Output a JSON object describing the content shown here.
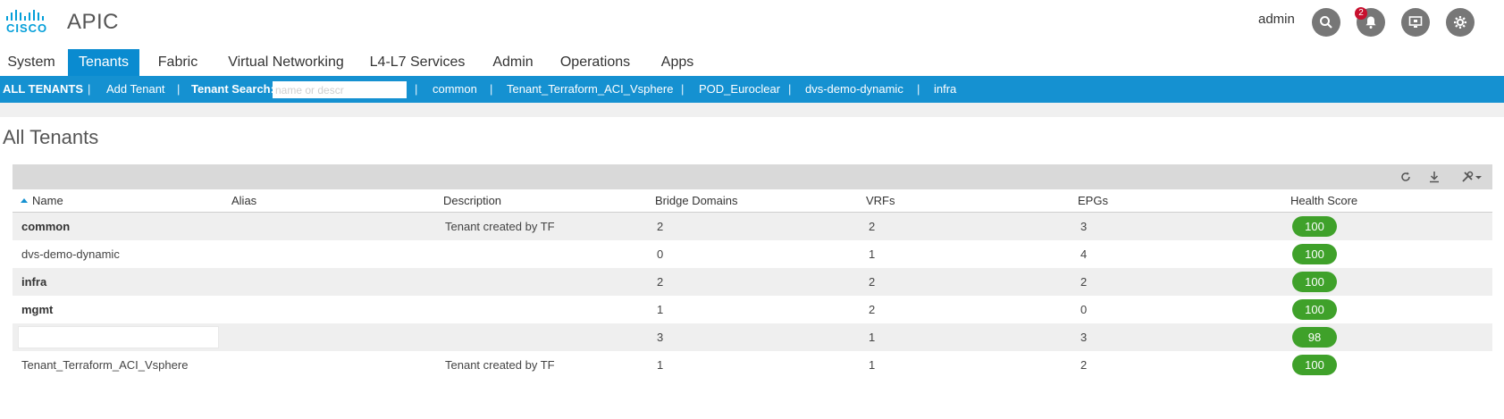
{
  "header": {
    "logo_text": "CISCO",
    "app_title": "APIC",
    "user": "admin",
    "notification_count": "2"
  },
  "tabs": [
    {
      "label": "System"
    },
    {
      "label": "Tenants"
    },
    {
      "label": "Fabric"
    },
    {
      "label": "Virtual Networking"
    },
    {
      "label": "L4-L7 Services"
    },
    {
      "label": "Admin"
    },
    {
      "label": "Operations"
    },
    {
      "label": "Apps"
    }
  ],
  "subnav": {
    "all_tenants": "ALL TENANTS",
    "add_tenant": "Add Tenant",
    "search_label": "Tenant Search:",
    "search_placeholder": "name or descr",
    "recent": [
      "common",
      "Tenant_Terraform_ACI_Vsphere",
      "POD_Euroclear",
      "dvs-demo-dynamic",
      "infra"
    ]
  },
  "page_title": "All Tenants",
  "table": {
    "columns": [
      "Name",
      "Alias",
      "Description",
      "Bridge Domains",
      "VRFs",
      "EPGs",
      "Health Score"
    ],
    "rows": [
      {
        "name": "common",
        "alias": "",
        "description": "Tenant created by TF",
        "bd": "2",
        "vrfs": "2",
        "epgs": "3",
        "health": "100"
      },
      {
        "name": "dvs-demo-dynamic",
        "alias": "",
        "description": "",
        "bd": "0",
        "vrfs": "1",
        "epgs": "4",
        "health": "100"
      },
      {
        "name": "infra",
        "alias": "",
        "description": "",
        "bd": "2",
        "vrfs": "2",
        "epgs": "2",
        "health": "100"
      },
      {
        "name": "mgmt",
        "alias": "",
        "description": "",
        "bd": "1",
        "vrfs": "2",
        "epgs": "0",
        "health": "100"
      },
      {
        "name": "",
        "alias": "",
        "description": "",
        "bd": "3",
        "vrfs": "1",
        "epgs": "3",
        "health": "98"
      },
      {
        "name": "Tenant_Terraform_ACI_Vsphere",
        "alias": "",
        "description": "Tenant created by TF",
        "bd": "1",
        "vrfs": "1",
        "epgs": "2",
        "health": "100"
      }
    ]
  },
  "colors": {
    "accent": "#1591d1",
    "active_tab": "#0a8bd0",
    "health_good": "#3fa12a",
    "badge": "#c8102e"
  }
}
